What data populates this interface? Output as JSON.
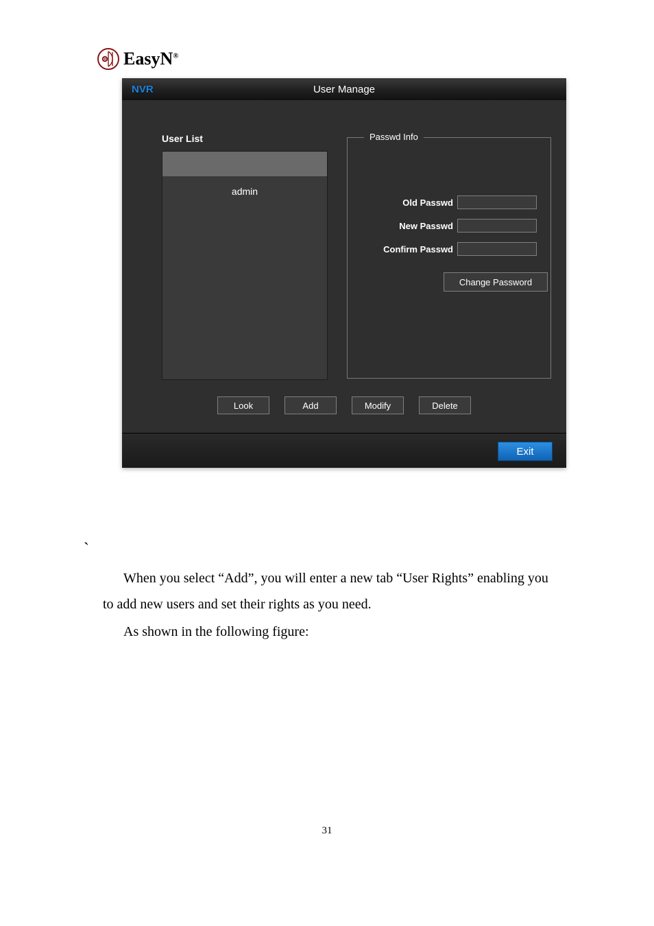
{
  "logo": {
    "text": "EasyN",
    "reg": "®"
  },
  "panel": {
    "brand": "NVR",
    "title": "User Manage",
    "userlist": {
      "label": "User List",
      "items": [
        "admin"
      ],
      "selected_index": 0
    },
    "passwd": {
      "legend": "Passwd Info",
      "old_label": "Old Passwd",
      "new_label": "New Passwd",
      "confirm_label": "Confirm Passwd",
      "old_value": "",
      "new_value": "",
      "confirm_value": "",
      "change_btn": "Change Password"
    },
    "actions": {
      "look": "Look",
      "add": "Add",
      "modify": "Modify",
      "delete": "Delete"
    },
    "exit": "Exit"
  },
  "doc": {
    "backtick": "`",
    "p1": "When you select “Add”, you will enter a new tab “User Rights” enabling you to add new users and set their rights as you need.",
    "p2": "As shown in the following figure:",
    "page_number": "31"
  }
}
